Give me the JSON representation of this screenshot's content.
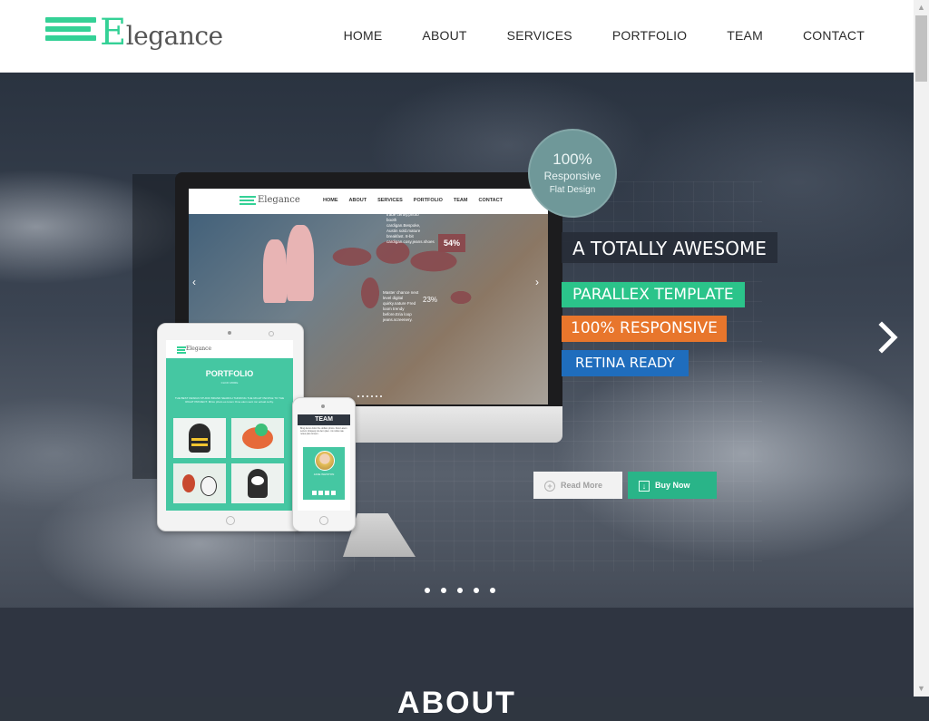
{
  "logo": {
    "text": "Elegance",
    "first_letter": "E",
    "rest": "legance"
  },
  "nav": [
    {
      "label": "HOME"
    },
    {
      "label": "ABOUT"
    },
    {
      "label": "SERVICES"
    },
    {
      "label": "PORTFOLIO"
    },
    {
      "label": "TEAM"
    },
    {
      "label": "CONTACT"
    }
  ],
  "hero": {
    "badge": {
      "line1": "100%",
      "line2": "Responsive",
      "line3": "Flat Design"
    },
    "taglines": {
      "awesome": "A TOTALLY AWESOME",
      "parallex": "PARALLEX TEMPLATE",
      "responsive": "100% RESPONSIVE",
      "retina": "RETINA READY"
    },
    "buttons": {
      "read_more": "Read More",
      "buy_now": "Buy Now"
    },
    "next_icon": "chevron-right-icon",
    "slides_count": 5,
    "colors": {
      "green": "#2bc48a",
      "orange": "#e8762c",
      "blue": "#1f6dbd",
      "dark": "#262c36"
    }
  },
  "mockup": {
    "imac": {
      "logo_text": "Elegance",
      "menu": [
        "HOME",
        "ABOUT",
        "SERVICES",
        "PORTFOLIO",
        "TEAM",
        "CONTACT"
      ],
      "stat_main": "54%",
      "stat_secondary": "23%",
      "note_top": "Pop-up static direct trade certify.photo booth cardigan.Bespoke, Austin sold.mature breakfast. 8-bit cardigan.cosy.jeans.shoes",
      "note_bottom": "Master chance next level digital quirky.nature Fred loom trendy before.Eria loop jeans.screenery."
    },
    "ipad": {
      "logo_text": "Elegance",
      "title": "PORTFOLIO",
      "subtitle": "CLICK MORE",
      "desc": "THE BEST DESIGN STUDIO BRAND SEARCH THINKING THE RIGHT PEOPLE TO THE RIGHT PROJECT. Mirco photo ex-lorem Ome elem seni ron actual cerby."
    },
    "iphone": {
      "title": "TEAM",
      "text": "Bing demo dolor the dollars photo. Duis Latem Lorum Uniquely ok dem plen. mt noble rate notes plan lorsem.",
      "name": "JANE WHISTON"
    }
  },
  "about": {
    "title": "ABOUT"
  },
  "scrollbar": {
    "up_icon": "▲",
    "down_icon": "▼"
  }
}
